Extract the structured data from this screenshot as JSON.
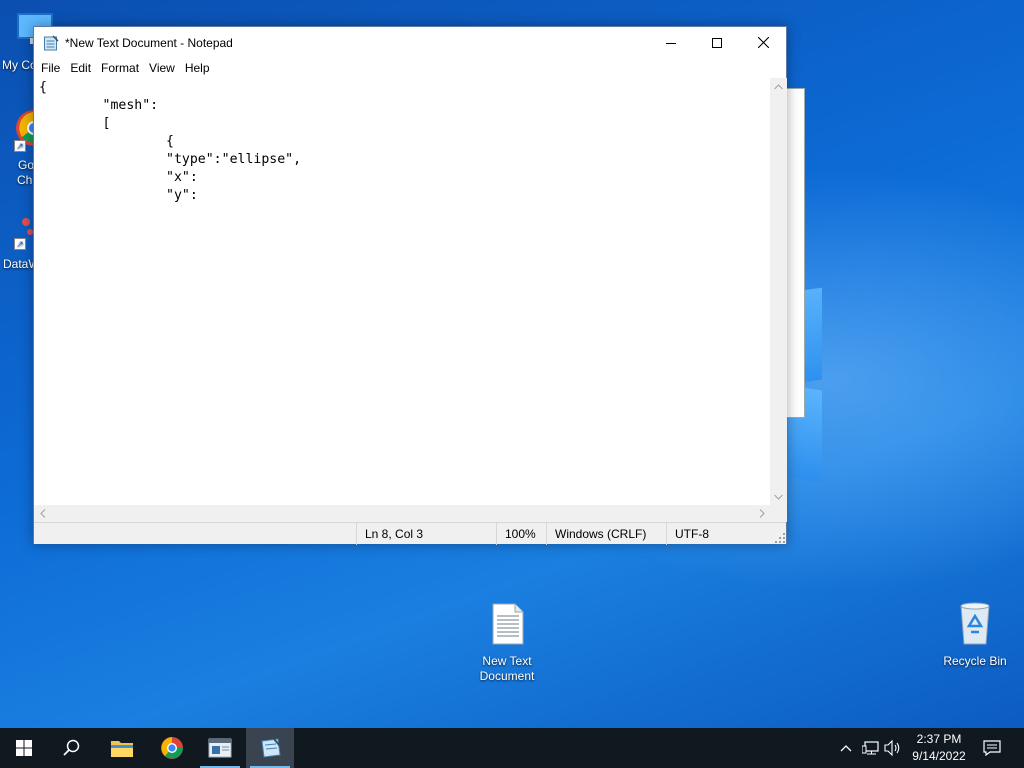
{
  "desktop": {
    "icons": [
      {
        "name": "my-computer",
        "label": "My Co"
      },
      {
        "name": "google-chrome",
        "label_line1": "Go",
        "label_line2": "Ch"
      },
      {
        "name": "datawrapper",
        "label": "DataW"
      },
      {
        "name": "new-text-document",
        "label_line1": "New Text",
        "label_line2": "Document"
      },
      {
        "name": "recycle-bin",
        "label": "Recycle Bin"
      }
    ]
  },
  "notepad": {
    "title": "*New Text Document - Notepad",
    "menu": [
      "File",
      "Edit",
      "Format",
      "View",
      "Help"
    ],
    "content": "{\n\t\"mesh\":\n\t[\n\t\t{\n\t\t\"type\":\"ellipse\",\n\t\t\"x\":\n\t\t\"y\":",
    "status": {
      "position": "Ln 8, Col 3",
      "zoom": "100%",
      "line_ending": "Windows (CRLF)",
      "encoding": "UTF-8"
    }
  },
  "taskbar": {
    "buttons": [
      "start-icon",
      "search-icon",
      "file-explorer-icon",
      "chrome-icon",
      "app-window-icon",
      "notepad-icon"
    ],
    "clock": {
      "time": "2:37 PM",
      "date": "9/14/2022"
    }
  },
  "colors": {
    "wallpaper": "#0d6bd6",
    "taskbar": "#101820",
    "accent": "#76b9ed"
  }
}
